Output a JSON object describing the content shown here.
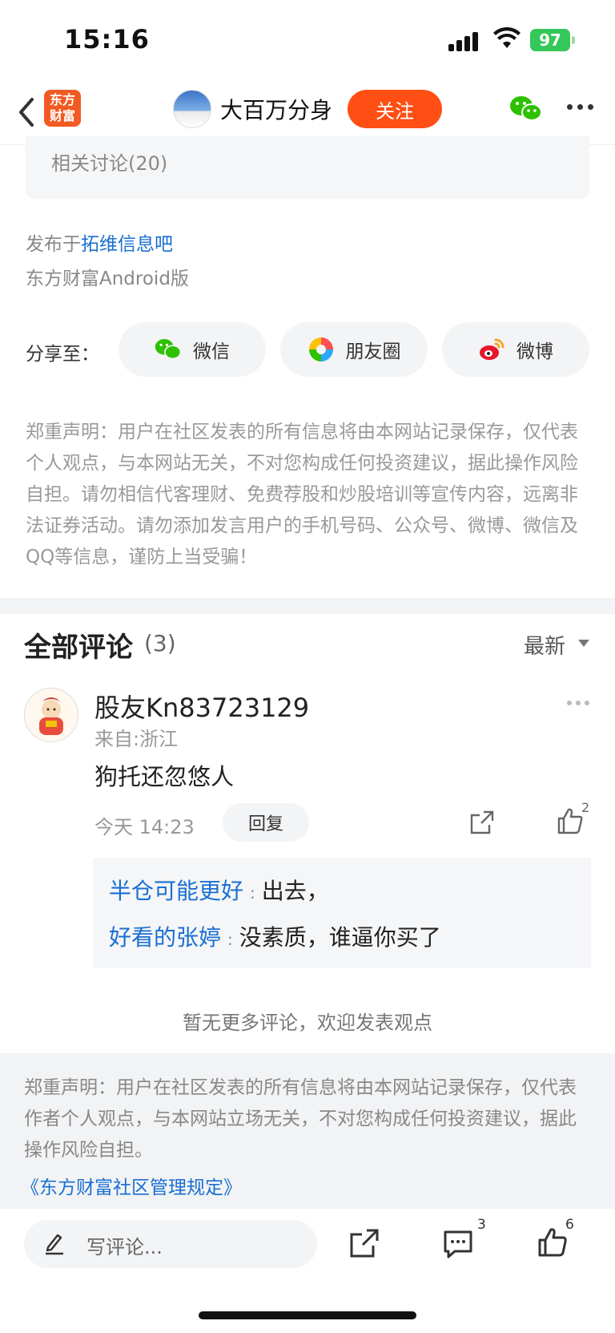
{
  "status_bar": {
    "time": "15:16",
    "battery": "97"
  },
  "nav": {
    "logo_line1": "东方",
    "logo_line2": "财富",
    "title": "大百万分身",
    "follow_label": "关注"
  },
  "post": {
    "related": "相关讨论(20)",
    "published_prefix": "发布于",
    "published_bar": "拓维信息吧",
    "platform": "东方财富Android版",
    "share_label": "分享至：",
    "share_wechat": "微信",
    "share_moments": "朋友圈",
    "share_weibo": "微博",
    "disclaimer": "郑重声明：用户在社区发表的所有信息将由本网站记录保存，仅代表个人观点，与本网站无关，不对您构成任何投资建议，据此操作风险自担。请勿相信代客理财、免费荐股和炒股培训等宣传内容，远离非法证券活动。请勿添加发言用户的手机号码、公众号、微博、微信及QQ等信息，谨防上当受骗！"
  },
  "comments": {
    "title": "全部评论",
    "count": "(3)",
    "sort": "最新",
    "items": [
      {
        "user": "股友Kn83723129",
        "from": "来自:浙江",
        "text": "狗托还忽悠人",
        "time": "今天 14:23",
        "reply_label": "回复",
        "likes": "2",
        "replies": [
          {
            "name": "半仓可能更好",
            "sep": ":",
            "text": "出去，"
          },
          {
            "name": "好看的张婷",
            "sep": ":",
            "text": "没素质，谁逼你买了"
          }
        ]
      }
    ],
    "no_more": "暂无更多评论，欢迎发表观点"
  },
  "footer": {
    "disclaimer": "郑重声明：用户在社区发表的所有信息将由本网站记录保存，仅代表作者个人观点，与本网站立场无关，不对您构成任何投资建议，据此操作风险自担。",
    "rules_link": "《东方财富社区管理规定》"
  },
  "bottom_bar": {
    "placeholder": "写评论...",
    "comment_count": "3",
    "like_count": "6"
  },
  "colors": {
    "accent": "#ff4f14",
    "link": "#1a6fd1",
    "brand": "#f15a22"
  }
}
